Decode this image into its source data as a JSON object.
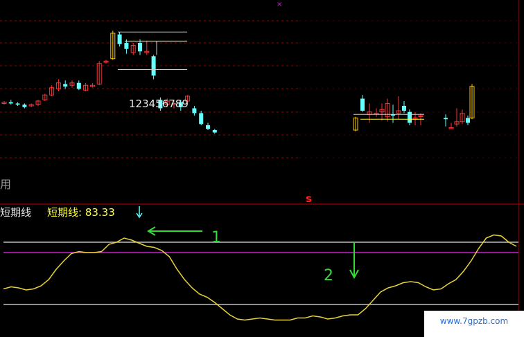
{
  "indicator": {
    "name": "短期线",
    "label": "短期线: 83.33",
    "name_color": "#e8e8e8",
    "label_color": "#ffff33"
  },
  "annotations": {
    "marker_1": "1",
    "marker_2": "2",
    "price_markers": "123456789",
    "side_text": "用",
    "signal_letter": "s",
    "arrow_color": "#33dd33"
  },
  "watermark": "www.7gpzb.com",
  "colors": {
    "background": "#000000",
    "up_candle": "#ff3333",
    "down_candle": "#66ffff",
    "highlight_candle": "#ffcc00",
    "grid": "#990000",
    "oscillator": "#e8d23a",
    "level_gray": "#bfbfbf",
    "level_magenta": "#cc22cc",
    "separator": "#cc0000"
  },
  "chart_data": [
    {
      "type": "candlestick",
      "title": "",
      "candles": [
        {
          "o": 4.6,
          "c": 4.7,
          "h": 4.8,
          "l": 4.5
        },
        {
          "o": 4.7,
          "c": 4.6,
          "h": 4.9,
          "l": 4.5
        },
        {
          "o": 4.6,
          "c": 4.5,
          "h": 4.7,
          "l": 4.4
        },
        {
          "o": 4.5,
          "c": 4.3,
          "h": 4.6,
          "l": 4.2
        },
        {
          "o": 4.4,
          "c": 4.5,
          "h": 4.6,
          "l": 4.3
        },
        {
          "o": 4.5,
          "c": 4.8,
          "h": 4.9,
          "l": 4.4
        },
        {
          "o": 4.9,
          "c": 5.3,
          "h": 5.4,
          "l": 4.8
        },
        {
          "o": 5.3,
          "c": 5.9,
          "h": 6.1,
          "l": 5.2
        },
        {
          "o": 5.8,
          "c": 6.3,
          "h": 6.6,
          "l": 5.6
        },
        {
          "o": 6.2,
          "c": 6.0,
          "h": 6.5,
          "l": 5.8
        },
        {
          "o": 6.1,
          "c": 6.3,
          "h": 6.5,
          "l": 5.9
        },
        {
          "o": 6.3,
          "c": 5.8,
          "h": 6.5,
          "l": 5.7
        },
        {
          "o": 5.7,
          "c": 6.1,
          "h": 6.3,
          "l": 5.6
        },
        {
          "o": 6.0,
          "c": 6.1,
          "h": 6.3,
          "l": 5.9
        },
        {
          "o": 6.2,
          "c": 7.9,
          "h": 8.1,
          "l": 6.1
        },
        {
          "o": 8.0,
          "c": 8.1,
          "h": 8.2,
          "l": 7.9
        },
        {
          "o": 8.3,
          "c": 10.4,
          "h": 10.6,
          "l": 8.2
        },
        {
          "o": 10.3,
          "c": 9.5,
          "h": 10.5,
          "l": 9.3
        },
        {
          "o": 9.6,
          "c": 9.1,
          "h": 9.9,
          "l": 8.7
        },
        {
          "o": 8.8,
          "c": 9.4,
          "h": 9.6,
          "l": 8.6
        },
        {
          "o": 9.6,
          "c": 8.9,
          "h": 9.9,
          "l": 8.6
        },
        {
          "o": 8.8,
          "c": 8.9,
          "h": 9.8,
          "l": 8.6
        },
        {
          "o": 8.5,
          "c": 6.9,
          "h": 8.6,
          "l": 6.6
        },
        {
          "o": 4.9,
          "c": 4.2,
          "h": 5.1,
          "l": 4.0
        },
        {
          "o": 4.5,
          "c": 4.8,
          "h": 5.0,
          "l": 4.3
        },
        {
          "o": 4.5,
          "c": 4.6,
          "h": 4.9,
          "l": 4.2
        },
        {
          "o": 4.7,
          "c": 4.3,
          "h": 4.9,
          "l": 4.0
        },
        {
          "o": 4.8,
          "c": 5.2,
          "h": 5.3,
          "l": 4.7
        },
        {
          "o": 4.2,
          "c": 3.8,
          "h": 4.4,
          "l": 3.6
        },
        {
          "o": 3.8,
          "c": 2.9,
          "h": 4.0,
          "l": 2.8
        },
        {
          "o": 2.8,
          "c": 2.5,
          "h": 3.0,
          "l": 2.4
        },
        {
          "o": 2.4,
          "c": 2.2,
          "h": 2.5,
          "l": 2.1
        }
      ],
      "candles_right": [
        {
          "o": 2.4,
          "c": 3.4,
          "h": 3.5,
          "l": 2.3
        },
        {
          "o": 5.0,
          "c": 4.0,
          "h": 5.3,
          "l": 3.9
        },
        {
          "o": 3.7,
          "c": 3.9,
          "h": 4.6,
          "l": 3.0
        },
        {
          "o": 3.8,
          "c": 3.8,
          "h": 4.2,
          "l": 3.5
        },
        {
          "o": 3.9,
          "c": 4.1,
          "h": 4.6,
          "l": 3.2
        },
        {
          "o": 3.5,
          "c": 4.6,
          "h": 5.0,
          "l": 3.1
        },
        {
          "o": 3.7,
          "c": 3.6,
          "h": 4.5,
          "l": 3.0
        },
        {
          "o": 3.8,
          "c": 4.0,
          "h": 5.2,
          "l": 3.3
        },
        {
          "o": 4.4,
          "c": 4.0,
          "h": 4.8,
          "l": 3.8
        },
        {
          "o": 3.9,
          "c": 3.0,
          "h": 4.1,
          "l": 2.8
        },
        {
          "o": 3.3,
          "c": 3.4,
          "h": 3.9,
          "l": 2.8
        },
        {
          "o": 3.6,
          "c": 3.6,
          "h": 3.8,
          "l": 2.8
        },
        {
          "o": 3.4,
          "c": 3.3,
          "h": 3.7,
          "l": 2.7
        },
        {
          "o": 2.6,
          "c": 2.6,
          "h": 3.0,
          "l": 2.5
        },
        {
          "o": 2.9,
          "c": 3.1,
          "h": 4.2,
          "l": 2.7
        },
        {
          "o": 3.1,
          "c": 3.8,
          "h": 4.1,
          "l": 2.9
        },
        {
          "o": 3.4,
          "c": 3.0,
          "h": 3.6,
          "l": 2.8
        },
        {
          "o": 3.4,
          "c": 6.0,
          "h": 6.2,
          "l": 3.3
        }
      ],
      "ylim": [
        0,
        12
      ],
      "grid": true
    },
    {
      "type": "line",
      "title": "",
      "series": [
        {
          "name": "短期线",
          "values": [
            35,
            37,
            36,
            34,
            35,
            38,
            44,
            54,
            62,
            69,
            71,
            70,
            70,
            71,
            78,
            80,
            84,
            82,
            79,
            76,
            75,
            72,
            66,
            54,
            44,
            36,
            30,
            27,
            22,
            16,
            10,
            6,
            5,
            6,
            7,
            6,
            5,
            5,
            5,
            7,
            7,
            9,
            8,
            6,
            7,
            9,
            10,
            10,
            16,
            24,
            32,
            36,
            38,
            41,
            42,
            41,
            37,
            34,
            35,
            40,
            44,
            52,
            62,
            74,
            84,
            87,
            86,
            80,
            76
          ]
        }
      ],
      "levels": [
        80,
        70,
        20
      ],
      "ylim": [
        0,
        100
      ],
      "grid": false
    }
  ]
}
